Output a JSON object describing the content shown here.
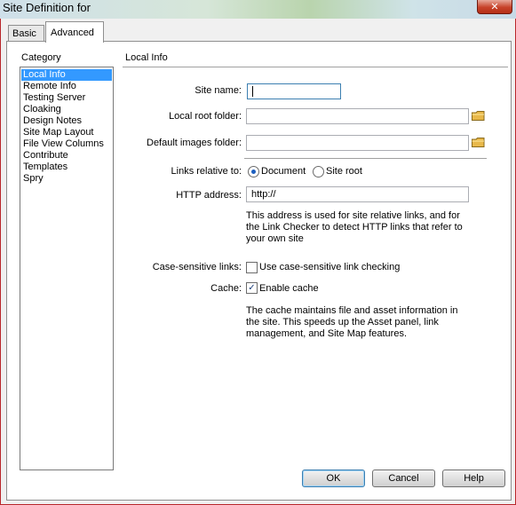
{
  "window": {
    "title": "Site Definition for",
    "close_label": "✕"
  },
  "tabs": [
    {
      "label": "Basic"
    },
    {
      "label": "Advanced"
    }
  ],
  "category": {
    "label": "Category",
    "items": [
      "Local Info",
      "Remote Info",
      "Testing Server",
      "Cloaking",
      "Design Notes",
      "Site Map Layout",
      "File View Columns",
      "Contribute",
      "Templates",
      "Spry"
    ],
    "selected": "Local Info"
  },
  "section": {
    "title": "Local Info"
  },
  "form": {
    "site_name_label": "Site name:",
    "site_name_value": "",
    "local_root_label": "Local root folder:",
    "local_root_value": "",
    "default_images_label": "Default images folder:",
    "default_images_value": "",
    "links_relative_label": "Links relative to:",
    "radio_document": "Document",
    "radio_site_root": "Site root",
    "http_label": "HTTP address:",
    "http_value": "http://",
    "http_note": "This address is used for site relative links, and for the Link Checker to detect HTTP links that refer to your own site",
    "case_label": "Case-sensitive links:",
    "case_checkbox": "Use case-sensitive link checking",
    "case_checked": false,
    "cache_label": "Cache:",
    "cache_checkbox": "Enable cache",
    "cache_checked": true,
    "cache_note": "The cache maintains file and asset information in the site.  This speeds up the Asset panel, link management, and Site Map features."
  },
  "buttons": {
    "ok": "OK",
    "cancel": "Cancel",
    "help": "Help"
  },
  "icons": {
    "folder": "folder-icon",
    "close": "close-icon"
  },
  "colors": {
    "selection": "#3399ff",
    "close_button": "#c7432a",
    "folder": "#e8b84a"
  }
}
